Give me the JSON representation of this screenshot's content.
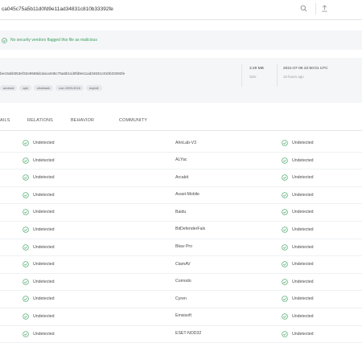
{
  "search": {
    "value": "ca045c75a5b11d0fd9e11ad34831c810b33392fe",
    "placeholder": ""
  },
  "toolbar": {
    "search_icon": "search-icon",
    "upload_icon": "upload-icon"
  },
  "banner": {
    "text": "No security vendors flagged this file as malicious",
    "icon": "check-circle-icon",
    "color": "#3aa05c"
  },
  "file": {
    "hash": "bec0abb053ef32e8588dcdaca045c75a5b11d0fd9e11ad34831c810b33392fe",
    "tags": [
      "android",
      "apk",
      "clickbank",
      "cve-1999-0016",
      "exploit"
    ],
    "size_value": "3.29 MB",
    "size_label": "Size",
    "date_value": "2021-07-06 22:50:01 UTC",
    "date_label": "15 hours ago"
  },
  "tabs": [
    "AILS",
    "RELATIONS",
    "BEHAVIOR",
    "COMMUNITY"
  ],
  "rows": [
    {
      "left_status": "Undetected",
      "vendor": "AhnLab-V3",
      "right_status": "Undetected"
    },
    {
      "left_status": "Undetected",
      "vendor": "ALYac",
      "right_status": "Undetected"
    },
    {
      "left_status": "Undetected",
      "vendor": "Arcabit",
      "right_status": "Undetected"
    },
    {
      "left_status": "Undetected",
      "vendor": "Avast-Mobile",
      "right_status": "Undetected"
    },
    {
      "left_status": "Undetected",
      "vendor": "Baidu",
      "right_status": "Undetected"
    },
    {
      "left_status": "Undetected",
      "vendor": "BitDefenderFalx",
      "right_status": "Undetected"
    },
    {
      "left_status": "Undetected",
      "vendor": "Bkav Pro",
      "right_status": "Undetected"
    },
    {
      "left_status": "Undetected",
      "vendor": "ClamAV",
      "right_status": "Undetected"
    },
    {
      "left_status": "Undetected",
      "vendor": "Comodo",
      "right_status": "Undetected"
    },
    {
      "left_status": "Undetected",
      "vendor": "Cyren",
      "right_status": "Undetected"
    },
    {
      "left_status": "Undetected",
      "vendor": "Emsisoft",
      "right_status": "Undetected"
    },
    {
      "left_status": "Undetected",
      "vendor": "ESET-NOD32",
      "right_status": "Undetected"
    }
  ],
  "colors": {
    "undetected": "#3aa05c",
    "band": "#f5f6f8",
    "border": "#e6e8ec"
  }
}
